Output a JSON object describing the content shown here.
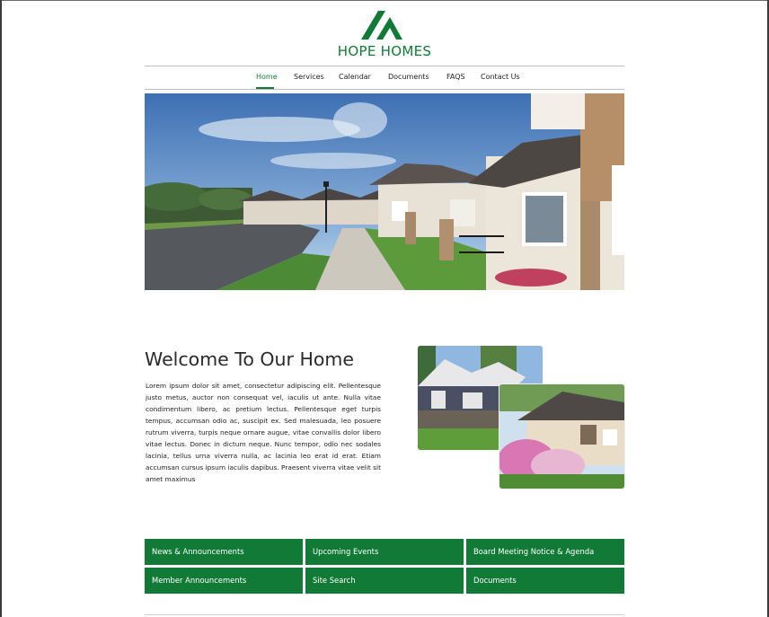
{
  "brand": {
    "name": "HOPE HOMES",
    "logo_icon": "triangle-roof-logo",
    "color": "#117a36"
  },
  "nav": {
    "items": [
      {
        "label": "Home",
        "active": true
      },
      {
        "label": "Services"
      },
      {
        "label": "Calendar"
      },
      {
        "label": "Documents"
      },
      {
        "label": "FAQS"
      },
      {
        "label": "Contact Us"
      }
    ]
  },
  "hero": {
    "description": "photo-suburban-street-with-houses"
  },
  "welcome": {
    "title": "Welcome To Our Home",
    "body": "Lorem ipsum dolor sit amet, consectetur adipiscing elit. Pellentesque justo metus, auctor non consequat vel, iaculis ut ante. Nulla vitae condimentum libero, ac pretium lectus. Pellentesque eget turpis tempus, accumsan odio ac, suscipit ex. Sed malesuada, leo posuere rutrum viverra, turpis neque ornare augue, vitae convallis dolor libero vitae lectus. Donec in dictum neque. Nunc tempor, odio nec sodales lacinia, tellus urna viverra nulla, ac lacinia leo erat id erat. Etiam accumsan cursus ipsum iaculis dapibus. Praesent viverra vitae velit sit amet maximus"
  },
  "tiles": [
    {
      "label": "News & Announcements"
    },
    {
      "label": "Upcoming Events"
    },
    {
      "label": "Board Meeting Notice & Agenda"
    },
    {
      "label": "Member Announcements"
    },
    {
      "label": "Site Search"
    },
    {
      "label": "Documents"
    }
  ],
  "colors": {
    "accent": "#117a36",
    "text": "#222222",
    "rule": "#bdbdbd"
  }
}
